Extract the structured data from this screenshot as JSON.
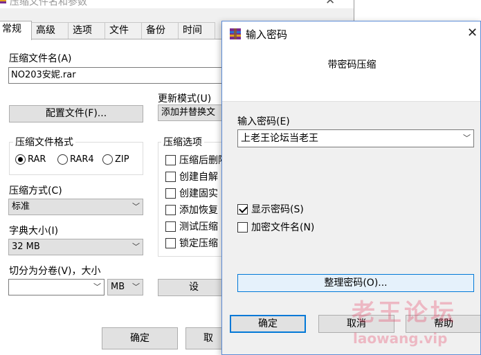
{
  "back_window": {
    "title": "压缩文件名和参数",
    "tabs": [
      {
        "label": "常规"
      },
      {
        "label": "高级"
      },
      {
        "label": "选项"
      },
      {
        "label": "文件"
      },
      {
        "label": "备份"
      },
      {
        "label": "时间"
      }
    ],
    "archive_name_label": "压缩文件名(A)",
    "archive_name_value": "NO203安妮.rar",
    "profiles_button": "配置文件(F)...",
    "update_mode_label": "更新模式(U)",
    "update_mode_value": "添加并替换文",
    "format_group_title": "压缩文件格式",
    "formats": [
      {
        "label": "RAR",
        "selected": true
      },
      {
        "label": "RAR4",
        "selected": false
      },
      {
        "label": "ZIP",
        "selected": false
      }
    ],
    "options_group_title": "压缩选项",
    "options": [
      {
        "label": "压缩后删除",
        "checked": false
      },
      {
        "label": "创建自解",
        "checked": false
      },
      {
        "label": "创建固实",
        "checked": false
      },
      {
        "label": "添加恢复",
        "checked": false
      },
      {
        "label": "测试压缩",
        "checked": false
      },
      {
        "label": "锁定压缩",
        "checked": false
      }
    ],
    "method_label": "压缩方式(C)",
    "method_value": "标准",
    "dict_label": "字典大小(I)",
    "dict_value": "32 MB",
    "split_label": "切分为分卷(V)，大小",
    "split_value": "",
    "split_unit": "MB",
    "set_password_button": "设",
    "ok_button": "确定",
    "cancel_button": "取"
  },
  "dialog": {
    "title": "输入密码",
    "heading": "带密码压缩",
    "password_label": "输入密码(E)",
    "password_value": "上老王论坛当老王",
    "show_password": {
      "label": "显示密码(S)",
      "checked": true
    },
    "encrypt_names": {
      "label": "加密文件名(N)",
      "checked": false
    },
    "organize_button": "整理密码(O)...",
    "ok_button": "确定",
    "cancel_button": "取消",
    "help_button": "帮助"
  },
  "watermark": {
    "text": "老王论坛",
    "url": "laowang.vip"
  },
  "colors": {
    "accent": "#0078d7",
    "dialog_border": "#5b8bd6",
    "button_face": "#e1e1e1",
    "watermark": "#e62850"
  }
}
